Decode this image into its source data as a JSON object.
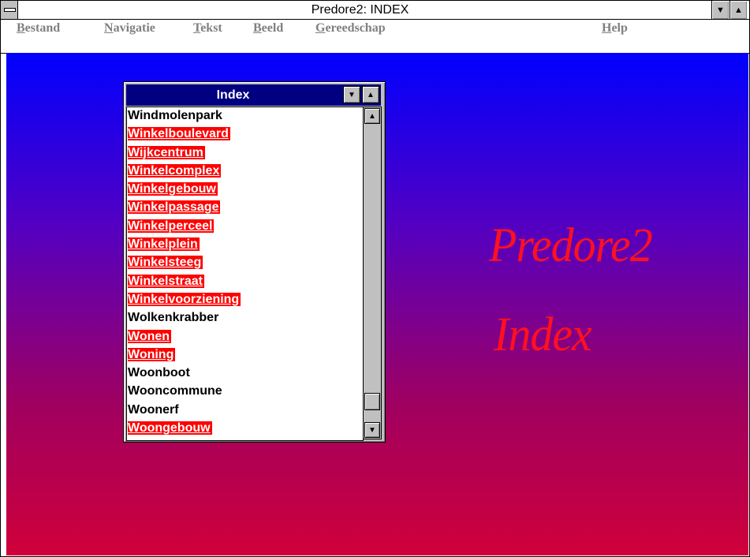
{
  "window": {
    "title": "Predore2: INDEX"
  },
  "menu": [
    {
      "label": "Bestand",
      "hotkey": "B",
      "rest": "estand"
    },
    {
      "label": "Navigatie",
      "hotkey": "N",
      "rest": "avigatie"
    },
    {
      "label": "Tekst",
      "hotkey": "T",
      "rest": "ekst"
    },
    {
      "label": "Beeld",
      "hotkey": "B",
      "rest": "eeld"
    },
    {
      "label": "Gereedschap",
      "hotkey": "G",
      "rest": "ereedschap"
    },
    {
      "label": "Help",
      "hotkey": "H",
      "rest": "elp"
    }
  ],
  "background": {
    "line1": "Predore2",
    "line2": "Index"
  },
  "index": {
    "title": "Index",
    "items": [
      {
        "text": "Windmolenpark",
        "link": false
      },
      {
        "text": "Winkelboulevard",
        "link": true
      },
      {
        "text": "Wijkcentrum",
        "link": true
      },
      {
        "text": "Winkelcomplex",
        "link": true
      },
      {
        "text": "Winkelgebouw",
        "link": true
      },
      {
        "text": "Winkelpassage",
        "link": true
      },
      {
        "text": "Winkelperceel",
        "link": true
      },
      {
        "text": "Winkelplein",
        "link": true
      },
      {
        "text": "Winkelsteeg",
        "link": true
      },
      {
        "text": "Winkelstraat",
        "link": true
      },
      {
        "text": "Winkelvoorziening",
        "link": true
      },
      {
        "text": "Wolkenkrabber",
        "link": false
      },
      {
        "text": "Wonen",
        "link": true
      },
      {
        "text": "Woning",
        "link": true
      },
      {
        "text": "Woonboot",
        "link": false
      },
      {
        "text": "Wooncommune",
        "link": false
      },
      {
        "text": "Woonerf",
        "link": false
      },
      {
        "text": "Woongebouw",
        "link": true
      }
    ]
  },
  "colors": {
    "link_bg": "#ff0000",
    "title_bg": "#000080",
    "deco_text": "#ff1020"
  }
}
